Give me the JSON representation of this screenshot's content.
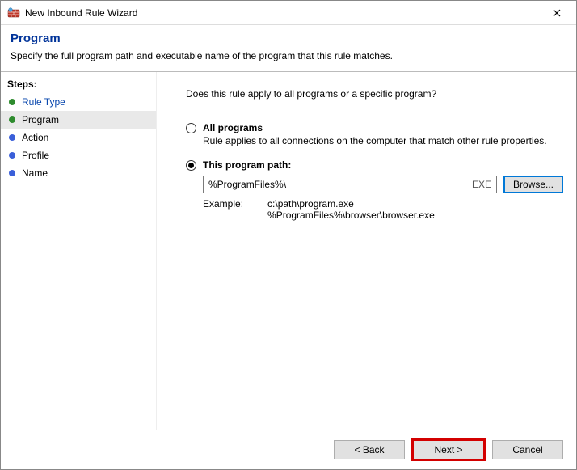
{
  "window": {
    "title": "New Inbound Rule Wizard"
  },
  "header": {
    "title": "Program",
    "desc": "Specify the full program path and executable name of the program that this rule matches."
  },
  "sidebar": {
    "header": "Steps:",
    "items": [
      {
        "label": "Rule Type",
        "bulletColor": "#2e8b2e",
        "link": true
      },
      {
        "label": "Program",
        "bulletColor": "#2e8b2e",
        "selected": true
      },
      {
        "label": "Action",
        "bulletColor": "#3a5fd9"
      },
      {
        "label": "Profile",
        "bulletColor": "#3a5fd9"
      },
      {
        "label": "Name",
        "bulletColor": "#3a5fd9"
      }
    ]
  },
  "main": {
    "question": "Does this rule apply to all programs or a specific program?",
    "option_all": {
      "label": "All programs",
      "desc": "Rule applies to all connections on the computer that match other rule properties."
    },
    "option_path": {
      "label": "This program path:",
      "value": "%ProgramFiles%\\",
      "ext": "EXE",
      "browse": "Browse...",
      "example_label": "Example:",
      "example1": "c:\\path\\program.exe",
      "example2": "%ProgramFiles%\\browser\\browser.exe"
    }
  },
  "buttons": {
    "back": "< Back",
    "next": "Next >",
    "cancel": "Cancel"
  }
}
